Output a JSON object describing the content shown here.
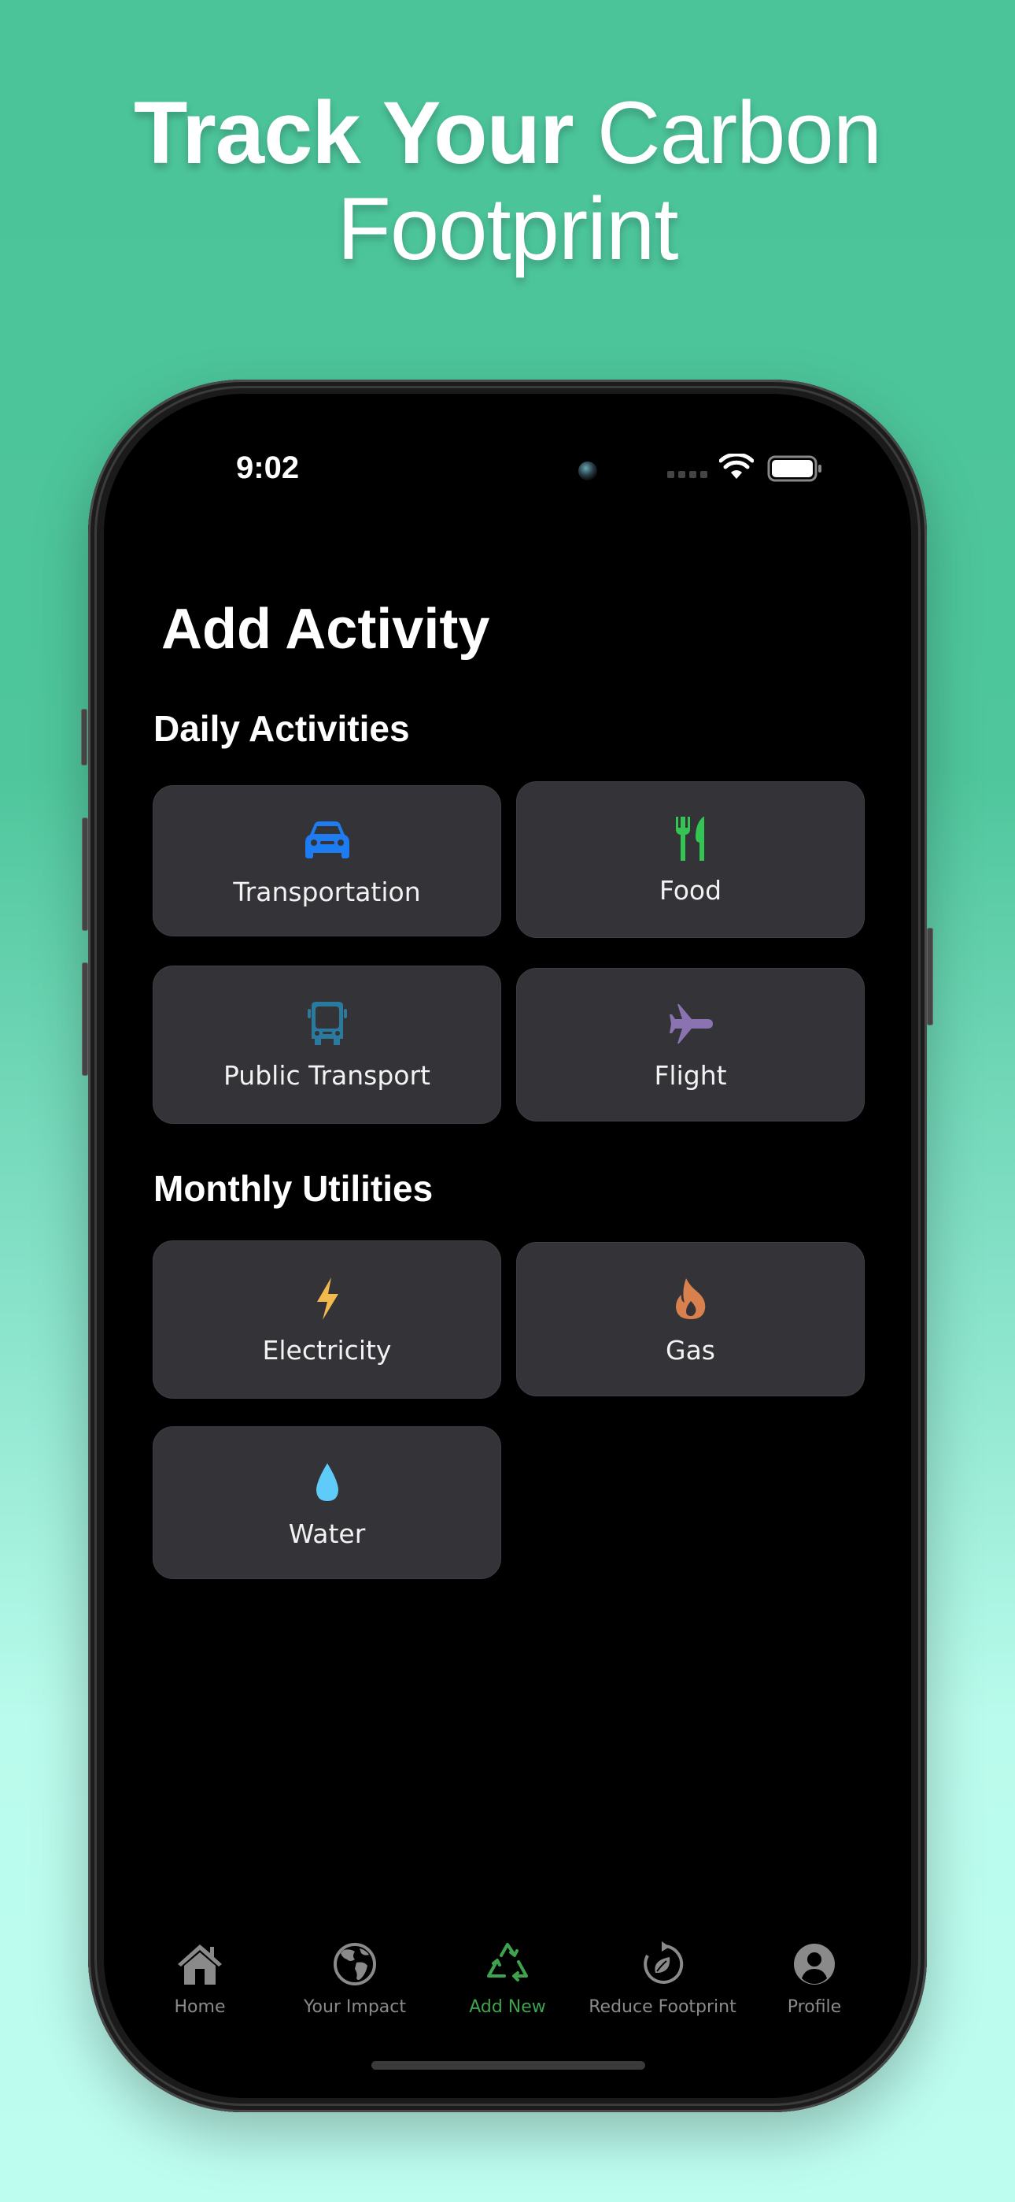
{
  "headline": {
    "bold": "Track Your",
    "light": "Carbon",
    "line2": "Footprint"
  },
  "status_bar": {
    "time": "9:02",
    "icons": [
      "front-camera",
      "signal-dots-icon",
      "wifi-icon",
      "battery-icon"
    ]
  },
  "page": {
    "title": "Add Activity"
  },
  "sections": [
    {
      "title": "Daily Activities",
      "items": [
        {
          "label": "Transportation",
          "icon": "car-icon",
          "color": "#1E7CF2"
        },
        {
          "label": "Food",
          "icon": "fork-knife-icon",
          "color": "#33C453"
        },
        {
          "label": "Public Transport",
          "icon": "bus-icon",
          "color": "#2A7A9E"
        },
        {
          "label": "Flight",
          "icon": "airplane-icon",
          "color": "#8A73B0"
        }
      ]
    },
    {
      "title": "Monthly Utilities",
      "items": [
        {
          "label": "Electricity",
          "icon": "bolt-icon",
          "color": "#F2BA4A"
        },
        {
          "label": "Gas",
          "icon": "flame-icon",
          "color": "#D9804F"
        },
        {
          "label": "Water",
          "icon": "drop-icon",
          "color": "#5FCBF8"
        }
      ]
    }
  ],
  "tab_bar": {
    "active_color": "#3FA34D",
    "inactive_color": "#8A8A8A",
    "tabs": [
      {
        "label": "Home",
        "icon": "house-icon",
        "active": false
      },
      {
        "label": "Your Impact",
        "icon": "globe-icon",
        "active": false
      },
      {
        "label": "Add New",
        "icon": "recycle-icon",
        "active": true
      },
      {
        "label": "Reduce Footprint",
        "icon": "leaf-cycle-icon",
        "active": false
      },
      {
        "label": "Profile",
        "icon": "person-circle-icon",
        "active": false
      }
    ]
  },
  "colors": {
    "background_top": "#4BC49A",
    "background_bottom": "#BDFDF0",
    "card_bg": "#333338",
    "screen_bg": "#000000"
  }
}
